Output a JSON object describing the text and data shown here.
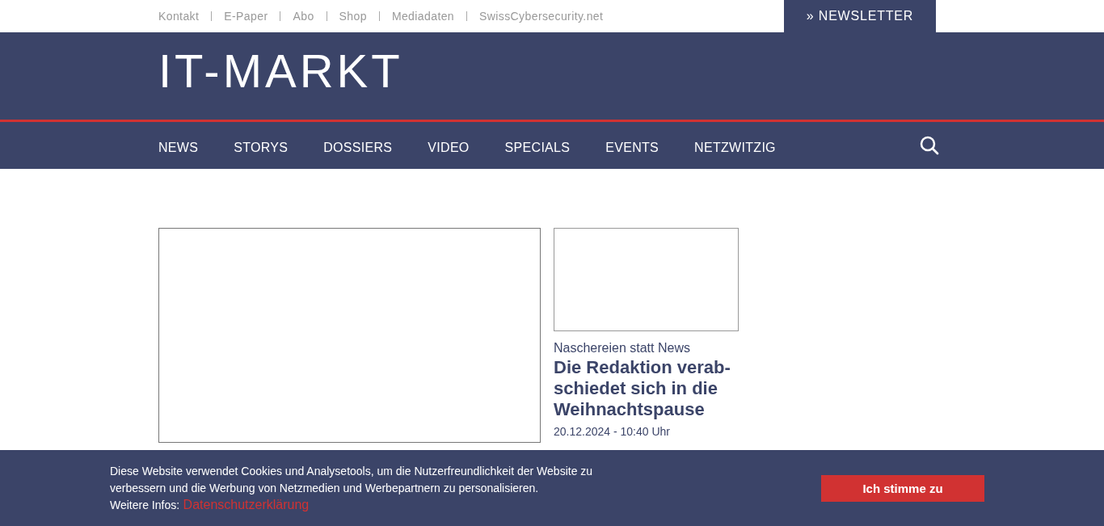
{
  "top_links": [
    "Kontakt",
    "E-Paper",
    "Abo",
    "Shop",
    "Mediadaten",
    "SwissCybersecurity.net"
  ],
  "newsletter_button": "» NEWSLETTER",
  "logo": "IT-MARKT",
  "nav": [
    "NEWS",
    "STORYS",
    "DOSSIERS",
    "VIDEO",
    "SPECIALS",
    "EVENTS",
    "NETZWITZIG"
  ],
  "teaser": {
    "kicker": "Naschereien statt News",
    "headline": "Die Redaktion verab-schiedet sich in die Weihnachtspause",
    "date": "20.12.2024 - 10:40 Uhr"
  },
  "cookie_banner": {
    "text": "Diese Website verwendet Cookies und Analysetools, um die Nutzerfreundlichkeit der Website zu verbessern und die Werbung von Netzmedien und Werbepartnern zu personalisieren.",
    "more_label": "Weitere Infos:",
    "link": "Datenschutzerklärung",
    "accept_button": "Ich stimme zu"
  }
}
